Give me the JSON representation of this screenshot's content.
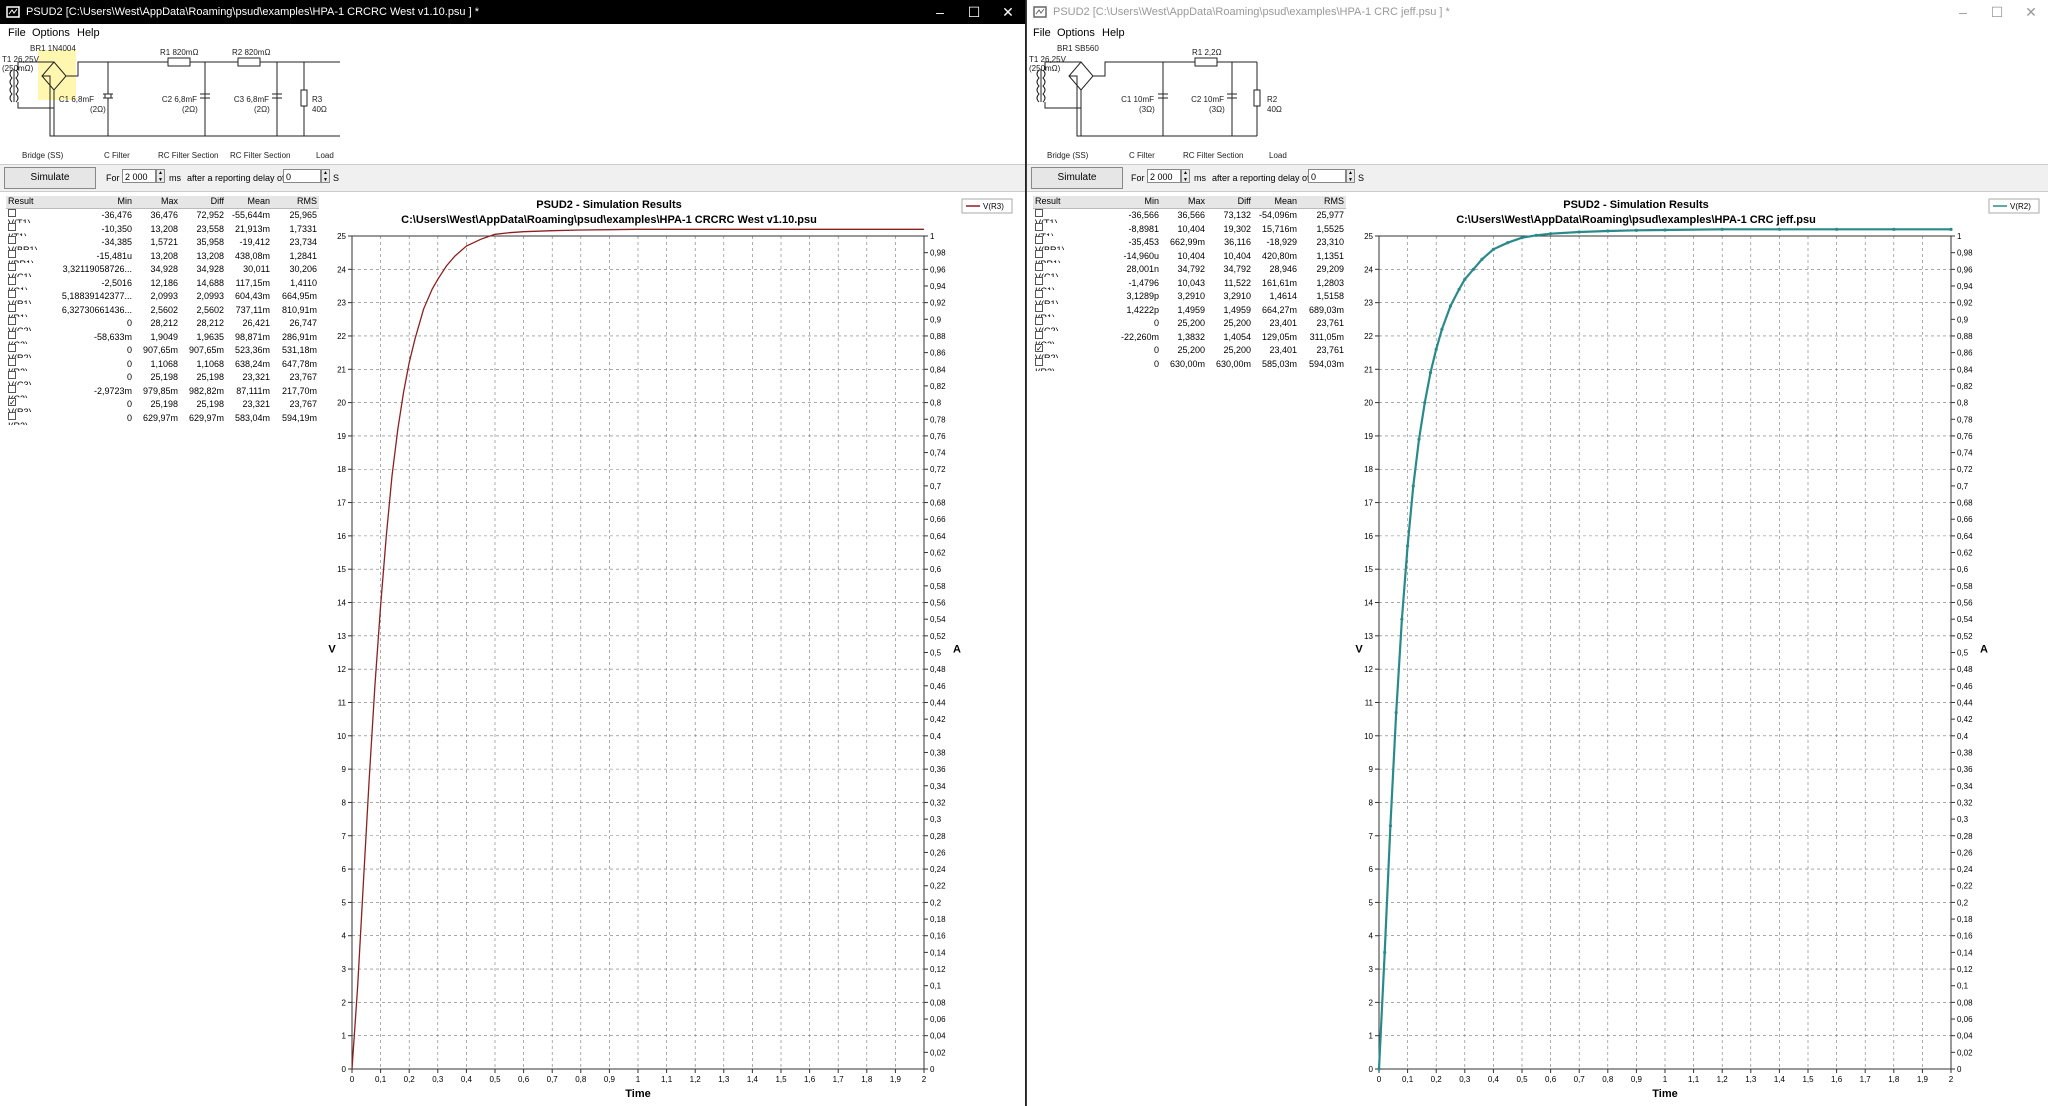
{
  "windows": [
    {
      "title": "PSUD2  [C:\\Users\\West\\AppData\\Roaming\\psud\\examples\\HPA-1 CRCRC West v1.10.psu ] *",
      "menu": [
        "File",
        "Options",
        "Help"
      ],
      "schematic": {
        "transformer": [
          "T1 26,25V",
          "(250mΩ)"
        ],
        "rectifier": "BR1 1N4004",
        "resistors": [
          "R1 820mΩ",
          "R2 820mΩ"
        ],
        "caps": [
          [
            "C1 6,8mF",
            "(2Ω)"
          ],
          [
            "C2 6,8mF",
            "(2Ω)"
          ],
          [
            "C3 6,8mF",
            "(2Ω)"
          ]
        ],
        "load": [
          "R3",
          "40Ω"
        ],
        "sections": [
          "Bridge (SS)",
          "C Filter",
          "RC Filter Section",
          "RC Filter Section",
          "Load"
        ]
      },
      "controls": {
        "simulate": "Simulate",
        "for_label": "For",
        "duration": "2 000",
        "ms_label": "ms",
        "delay_label": "after a reporting delay of",
        "delay": "0",
        "s_label": "S"
      },
      "table": {
        "headers": [
          "Result",
          "Min",
          "Max",
          "Diff",
          "Mean",
          "RMS"
        ],
        "rows": [
          [
            "V(T1)",
            "-36,476",
            "36,476",
            "72,952",
            "-55,644m",
            "25,965",
            false
          ],
          [
            "I(T1)",
            "-10,350",
            "13,208",
            "23,558",
            "21,913m",
            "1,7331",
            false
          ],
          [
            "V(BR1)",
            "-34,385",
            "1,5721",
            "35,958",
            "-19,412",
            "23,734",
            false
          ],
          [
            "I(BR1)",
            "-15,481u",
            "13,208",
            "13,208",
            "438,08m",
            "1,2841",
            false
          ],
          [
            "V(C1)",
            "3,32119058726...",
            "34,928",
            "34,928",
            "30,011",
            "30,206",
            false
          ],
          [
            "I(C1)",
            "-2,5016",
            "12,186",
            "14,688",
            "117,15m",
            "1,4110",
            false
          ],
          [
            "V(R1)",
            "5,18839142377...",
            "2,0993",
            "2,0993",
            "604,43m",
            "664,95m",
            false
          ],
          [
            "I(R1)",
            "6,32730661436...",
            "2,5602",
            "2,5602",
            "737,11m",
            "810,91m",
            false
          ],
          [
            "V(C2)",
            "0",
            "28,212",
            "28,212",
            "26,421",
            "26,747",
            false
          ],
          [
            "I(C2)",
            "-58,633m",
            "1,9049",
            "1,9635",
            "98,871m",
            "286,91m",
            false
          ],
          [
            "V(R2)",
            "0",
            "907,65m",
            "907,65m",
            "523,36m",
            "531,18m",
            false
          ],
          [
            "I(R2)",
            "0",
            "1,1068",
            "1,1068",
            "638,24m",
            "647,78m",
            false
          ],
          [
            "V(C3)",
            "0",
            "25,198",
            "25,198",
            "23,321",
            "23,767",
            false
          ],
          [
            "I(C3)",
            "-2,9723m",
            "979,85m",
            "982,82m",
            "87,111m",
            "217,70m",
            false
          ],
          [
            "V(R3)",
            "0",
            "25,198",
            "25,198",
            "23,321",
            "23,767",
            true
          ],
          [
            "I(R3)",
            "0",
            "629,97m",
            "629,97m",
            "583,04m",
            "594,19m",
            false
          ]
        ]
      },
      "chart": {
        "title": "PSUD2 - Simulation Results",
        "subtitle": "C:\\Users\\West\\AppData\\Roaming\\psud\\examples\\HPA-1 CRCRC West v1.10.psu",
        "legend": "V(R3)",
        "ylabel_left": "V",
        "ylabel_right": "A",
        "xlabel": "Time",
        "color": "#8b2020"
      }
    },
    {
      "title": "PSUD2  [C:\\Users\\West\\AppData\\Roaming\\psud\\examples\\HPA-1 CRC jeff.psu ] *",
      "menu": [
        "File",
        "Options",
        "Help"
      ],
      "schematic": {
        "transformer": [
          "T1 26,25V",
          "(250mΩ)"
        ],
        "rectifier": "BR1 SB560",
        "resistors": [
          "R1 2,2Ω"
        ],
        "caps": [
          [
            "C1 10mF",
            "(3Ω)"
          ],
          [
            "C2 10mF",
            "(3Ω)"
          ]
        ],
        "load": [
          "R2",
          "40Ω"
        ],
        "sections": [
          "Bridge (SS)",
          "C Filter",
          "RC Filter Section",
          "Load"
        ]
      },
      "controls": {
        "simulate": "Simulate",
        "for_label": "For",
        "duration": "2 000",
        "ms_label": "ms",
        "delay_label": "after a reporting delay of",
        "delay": "0",
        "s_label": "S"
      },
      "table": {
        "headers": [
          "Result",
          "Min",
          "Max",
          "Diff",
          "Mean",
          "RMS"
        ],
        "rows": [
          [
            "V(T1)",
            "-36,566",
            "36,566",
            "73,132",
            "-54,096m",
            "25,977",
            false
          ],
          [
            "I(T1)",
            "-8,8981",
            "10,404",
            "19,302",
            "15,716m",
            "1,5525",
            false
          ],
          [
            "V(BR1)",
            "-35,453",
            "662,99m",
            "36,116",
            "-18,929",
            "23,310",
            false
          ],
          [
            "I(BR1)",
            "-14,960u",
            "10,404",
            "10,404",
            "420,80m",
            "1,1351",
            false
          ],
          [
            "V(C1)",
            "28,001n",
            "34,792",
            "34,792",
            "28,946",
            "29,209",
            false
          ],
          [
            "I(C1)",
            "-1,4796",
            "10,043",
            "11,522",
            "161,61m",
            "1,2803",
            false
          ],
          [
            "V(R1)",
            "3,1289p",
            "3,2910",
            "3,2910",
            "1,4614",
            "1,5158",
            false
          ],
          [
            "I(R1)",
            "1,4222p",
            "1,4959",
            "1,4959",
            "664,27m",
            "689,03m",
            false
          ],
          [
            "V(C2)",
            "0",
            "25,200",
            "25,200",
            "23,401",
            "23,761",
            false
          ],
          [
            "I(C2)",
            "-22,260m",
            "1,3832",
            "1,4054",
            "129,05m",
            "311,05m",
            false
          ],
          [
            "V(R2)",
            "0",
            "25,200",
            "25,200",
            "23,401",
            "23,761",
            true
          ],
          [
            "I(R2)",
            "0",
            "630,00m",
            "630,00m",
            "585,03m",
            "594,03m",
            false
          ]
        ]
      },
      "chart": {
        "title": "PSUD2 - Simulation Results",
        "subtitle": "C:\\Users\\West\\AppData\\Roaming\\psud\\examples\\HPA-1 CRC jeff.psu",
        "legend": "V(R2)",
        "ylabel_left": "V",
        "ylabel_right": "A",
        "xlabel": "Time",
        "color": "#2a8a8a"
      }
    }
  ],
  "chart_data": [
    {
      "type": "line",
      "title": "PSUD2 - Simulation Results",
      "subtitle": "C:\\Users\\West\\AppData\\Roaming\\psud\\examples\\HPA-1 CRCRC West v1.10.psu",
      "xlabel": "Time",
      "ylabel": "V",
      "ylabel_right": "A",
      "xlim": [
        0,
        2
      ],
      "ylim": [
        0,
        25
      ],
      "ylim_right": [
        0,
        1
      ],
      "x_ticks": [
        "0",
        "0,1",
        "0,2",
        "0,3",
        "0,4",
        "0,5",
        "0,6",
        "0,7",
        "0,8",
        "0,9",
        "1",
        "1,1",
        "1,2",
        "1,3",
        "1,4",
        "1,5",
        "1,6",
        "1,7",
        "1,8",
        "1,9",
        "2"
      ],
      "y_ticks": [
        "0",
        "1",
        "2",
        "3",
        "4",
        "5",
        "6",
        "7",
        "8",
        "9",
        "10",
        "11",
        "12",
        "13",
        "14",
        "15",
        "16",
        "17",
        "18",
        "19",
        "20",
        "21",
        "22",
        "23",
        "24",
        "25"
      ],
      "y2_ticks": [
        "0",
        "0,02",
        "0,04",
        "0,06",
        "0,08",
        "0,1",
        "0,12",
        "0,14",
        "0,16",
        "0,18",
        "0,2",
        "0,22",
        "0,24",
        "0,26",
        "0,28",
        "0,3",
        "0,32",
        "0,34",
        "0,36",
        "0,38",
        "0,4",
        "0,42",
        "0,44",
        "0,46",
        "0,48",
        "0,5",
        "0,52",
        "0,54",
        "0,56",
        "0,58",
        "0,6",
        "0,62",
        "0,64",
        "0,66",
        "0,68",
        "0,7",
        "0,72",
        "0,74",
        "0,76",
        "0,78",
        "0,8",
        "0,82",
        "0,84",
        "0,86",
        "0,88",
        "0,9",
        "0,92",
        "0,94",
        "0,96",
        "0,98",
        "1"
      ],
      "grid": true,
      "legend": "top-right",
      "series": [
        {
          "name": "V(R3)",
          "x": [
            0,
            0.02,
            0.04,
            0.06,
            0.08,
            0.1,
            0.12,
            0.14,
            0.16,
            0.18,
            0.2,
            0.22,
            0.25,
            0.28,
            0.3,
            0.33,
            0.36,
            0.4,
            0.45,
            0.5,
            0.55,
            0.6,
            0.7,
            0.8,
            0.9,
            1.0,
            1.2,
            1.4,
            1.6,
            1.8,
            2.0
          ],
          "y": [
            0,
            2.5,
            5.6,
            8.7,
            11.5,
            13.9,
            16.0,
            17.8,
            19.2,
            20.3,
            21.2,
            21.9,
            22.8,
            23.4,
            23.7,
            24.1,
            24.4,
            24.7,
            24.9,
            25.05,
            25.1,
            25.13,
            25.16,
            25.18,
            25.19,
            25.2,
            25.2,
            25.2,
            25.2,
            25.2,
            25.2
          ]
        }
      ]
    },
    {
      "type": "line",
      "title": "PSUD2 - Simulation Results",
      "subtitle": "C:\\Users\\West\\AppData\\Roaming\\psud\\examples\\HPA-1 CRC jeff.psu",
      "xlabel": "Time",
      "ylabel": "V",
      "ylabel_right": "A",
      "xlim": [
        0,
        2
      ],
      "ylim": [
        0,
        25
      ],
      "ylim_right": [
        0,
        1
      ],
      "x_ticks": [
        "0",
        "0,1",
        "0,2",
        "0,3",
        "0,4",
        "0,5",
        "0,6",
        "0,7",
        "0,8",
        "0,9",
        "1",
        "1,1",
        "1,2",
        "1,3",
        "1,4",
        "1,5",
        "1,6",
        "1,7",
        "1,8",
        "1,9",
        "2"
      ],
      "y_ticks": [
        "0",
        "1",
        "2",
        "3",
        "4",
        "5",
        "6",
        "7",
        "8",
        "9",
        "10",
        "11",
        "12",
        "13",
        "14",
        "15",
        "16",
        "17",
        "18",
        "19",
        "20",
        "21",
        "22",
        "23",
        "24",
        "25"
      ],
      "y2_ticks": [
        "0",
        "0,02",
        "0,04",
        "0,06",
        "0,08",
        "0,1",
        "0,12",
        "0,14",
        "0,16",
        "0,18",
        "0,2",
        "0,22",
        "0,24",
        "0,26",
        "0,28",
        "0,3",
        "0,32",
        "0,34",
        "0,36",
        "0,38",
        "0,4",
        "0,42",
        "0,44",
        "0,46",
        "0,48",
        "0,5",
        "0,52",
        "0,54",
        "0,56",
        "0,58",
        "0,6",
        "0,62",
        "0,64",
        "0,66",
        "0,68",
        "0,7",
        "0,72",
        "0,74",
        "0,76",
        "0,78",
        "0,8",
        "0,82",
        "0,84",
        "0,86",
        "0,88",
        "0,9",
        "0,92",
        "0,94",
        "0,96",
        "0,98",
        "1"
      ],
      "grid": true,
      "legend": "top-right",
      "series": [
        {
          "name": "V(R2)",
          "x": [
            0,
            0.02,
            0.04,
            0.06,
            0.08,
            0.1,
            0.12,
            0.14,
            0.16,
            0.18,
            0.2,
            0.22,
            0.25,
            0.28,
            0.3,
            0.33,
            0.36,
            0.4,
            0.45,
            0.5,
            0.55,
            0.6,
            0.7,
            0.8,
            0.9,
            1.0,
            1.2,
            1.4,
            1.6,
            1.8,
            2.0
          ],
          "y": [
            0,
            3.5,
            7.3,
            10.7,
            13.5,
            15.7,
            17.5,
            18.9,
            20.0,
            20.9,
            21.6,
            22.2,
            22.9,
            23.4,
            23.7,
            24.0,
            24.3,
            24.6,
            24.8,
            24.95,
            25.02,
            25.07,
            25.12,
            25.15,
            25.17,
            25.18,
            25.2,
            25.2,
            25.2,
            25.2,
            25.2
          ]
        }
      ]
    }
  ]
}
